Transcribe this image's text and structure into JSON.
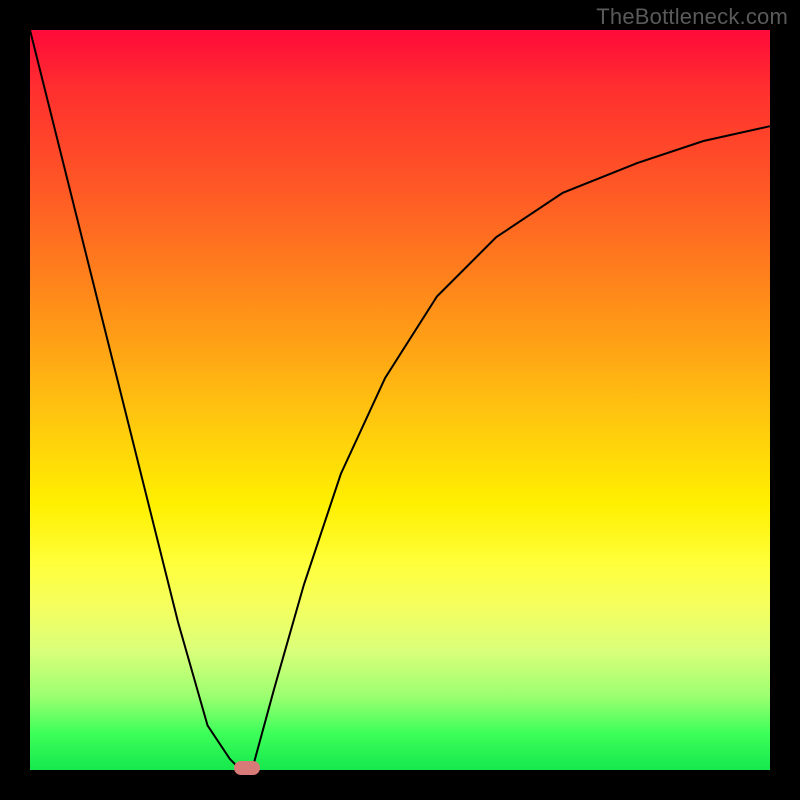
{
  "watermark": "TheBottleneck.com",
  "chart_data": {
    "type": "line",
    "title": "",
    "xlabel": "",
    "ylabel": "",
    "xlim": [
      0,
      1
    ],
    "ylim": [
      0,
      1
    ],
    "legend": false,
    "axes_visible": false,
    "background_gradient": {
      "orientation": "vertical",
      "stops": [
        {
          "pos": 0.0,
          "color": "#ff0a3a"
        },
        {
          "pos": 0.08,
          "color": "#ff2f2f"
        },
        {
          "pos": 0.22,
          "color": "#ff5a25"
        },
        {
          "pos": 0.36,
          "color": "#ff8a1a"
        },
        {
          "pos": 0.52,
          "color": "#ffc50f"
        },
        {
          "pos": 0.64,
          "color": "#fff000"
        },
        {
          "pos": 0.72,
          "color": "#ffff3a"
        },
        {
          "pos": 0.78,
          "color": "#f4ff60"
        },
        {
          "pos": 0.84,
          "color": "#d9ff7a"
        },
        {
          "pos": 0.9,
          "color": "#9cff70"
        },
        {
          "pos": 0.95,
          "color": "#3eff5a"
        },
        {
          "pos": 1.0,
          "color": "#15e84d"
        }
      ]
    },
    "series": [
      {
        "name": "left-branch",
        "stroke": "#000000",
        "stroke_width": 2,
        "x": [
          0.0,
          0.05,
          0.1,
          0.15,
          0.2,
          0.24,
          0.27,
          0.285
        ],
        "y": [
          1.0,
          0.8,
          0.6,
          0.4,
          0.2,
          0.06,
          0.015,
          0.0
        ]
      },
      {
        "name": "right-branch",
        "stroke": "#000000",
        "stroke_width": 2,
        "x": [
          0.3,
          0.33,
          0.37,
          0.42,
          0.48,
          0.55,
          0.63,
          0.72,
          0.82,
          0.91,
          1.0
        ],
        "y": [
          0.0,
          0.11,
          0.25,
          0.4,
          0.53,
          0.64,
          0.72,
          0.78,
          0.82,
          0.85,
          0.87
        ]
      }
    ],
    "marker": {
      "name": "optimum-marker",
      "shape": "rounded-rect",
      "color": "#d87a78",
      "x": 0.293,
      "y": 0.003
    }
  }
}
